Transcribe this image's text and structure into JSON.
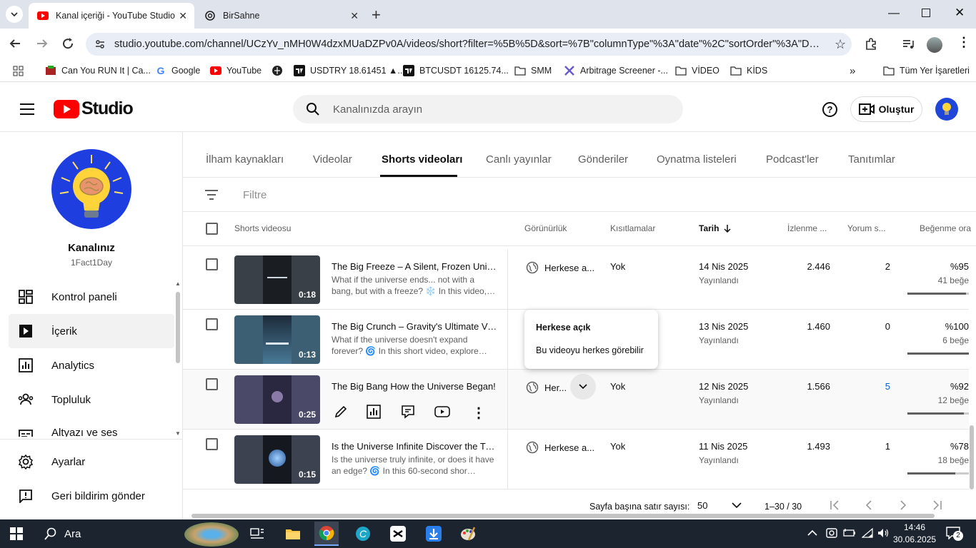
{
  "browser": {
    "tabs": [
      {
        "title": "Kanal içeriği - YouTube Studio",
        "active": true
      },
      {
        "title": "BirSahne",
        "active": false
      }
    ],
    "url": "studio.youtube.com/channel/UCzYv_nMH0W4dzxMUaDZPv0A/videos/short?filter=%5B%5D&sort=%7B\"columnType\"%3A\"date\"%2C\"sortOrder\"%3A\"DESCEN…",
    "bookmarks": [
      "Can You RUN It | Ca...",
      "Google",
      "YouTube",
      "USDTRY 18.61451 ▲...",
      "BTCUSDT 16125.74...",
      "SMM",
      "Arbitrage Screener -...",
      "VİDEO",
      "KİDS"
    ],
    "all_bookmarks": "Tüm Yer İşaretleri"
  },
  "header": {
    "logo_text": "Studio",
    "search_placeholder": "Kanalınızda arayın",
    "create_label": "Oluştur"
  },
  "sidebar": {
    "channel_title": "Kanalınız",
    "channel_name": "1Fact1Day",
    "items": [
      {
        "label": "Kontrol paneli",
        "active": false
      },
      {
        "label": "İçerik",
        "active": true
      },
      {
        "label": "Analytics",
        "active": false
      },
      {
        "label": "Topluluk",
        "active": false
      },
      {
        "label": "Altyazı ve ses",
        "active": false
      }
    ],
    "bottom_items": [
      "Ayarlar",
      "Geri bildirim gönder"
    ]
  },
  "content_tabs": [
    "İlham kaynakları",
    "Videolar",
    "Shorts videoları",
    "Canlı yayınlar",
    "Gönderiler",
    "Oynatma listeleri",
    "Podcast'ler",
    "Tanıtımlar"
  ],
  "active_tab": "Shorts videoları",
  "filter_placeholder": "Filtre",
  "columns": {
    "video": "Shorts videosu",
    "visibility": "Görünürlük",
    "restrictions": "Kısıtlamalar",
    "date": "Tarih",
    "views": "İzlenme ...",
    "comments": "Yorum s...",
    "likes": "Beğenme ora"
  },
  "rows": [
    {
      "title": "The Big Freeze – A Silent, Frozen Universe",
      "desc": "What if the universe ends... not with a bang, but with a freeze? ❄️ In this video,…",
      "duration": "0:18",
      "visibility": "Herkese a...",
      "restrictions": "Yok",
      "date": "14 Nis 2025",
      "status": "Yayınlandı",
      "views": "2.446",
      "comments": "2",
      "likes": "%95",
      "like_count": "41 beğe",
      "like_ratio": 0.95
    },
    {
      "title": "The Big Crunch – Gravity's Ultimate Victory",
      "desc": "What if the universe doesn't expand forever? 🌀 In this short video, explore…",
      "duration": "0:13",
      "visibility": "",
      "restrictions": "",
      "date": "13 Nis 2025",
      "status": "Yayınlandı",
      "views": "1.460",
      "comments": "0",
      "likes": "%100",
      "like_count": "6 beğe",
      "like_ratio": 1.0
    },
    {
      "title": "The Big Bang How the Universe Began!",
      "desc": "",
      "duration": "0:25",
      "visibility": "Her...",
      "restrictions": "Yok",
      "date": "12 Nis 2025",
      "status": "Yayınlandı",
      "views": "1.566",
      "comments": "5",
      "likes": "%92",
      "like_count": "12 beğe",
      "like_ratio": 0.92
    },
    {
      "title": "Is the Universe Infinite Discover the Truth",
      "desc": "Is the universe truly infinite, or does it have an edge? 🌀 In this 60-second shor…",
      "duration": "0:15",
      "visibility": "Herkese a...",
      "restrictions": "Yok",
      "date": "11 Nis 2025",
      "status": "Yayınlandı",
      "views": "1.493",
      "comments": "1",
      "likes": "%78",
      "like_count": "18 beğe",
      "like_ratio": 0.78
    }
  ],
  "tooltip": {
    "title": "Herkese açık",
    "body": "Bu videoyu herkes görebilir"
  },
  "footer": {
    "rows_per_page_label": "Sayfa başına satır sayısı:",
    "rows_per_page": "50",
    "range": "1–30 / 30"
  },
  "taskbar": {
    "search": "Ara",
    "time": "14:46",
    "date": "30.06.2025",
    "notifications": "2"
  },
  "colors": {
    "accent_red": "#ff0000",
    "link_blue": "#065fd4",
    "taskbar": "#1c2430"
  }
}
